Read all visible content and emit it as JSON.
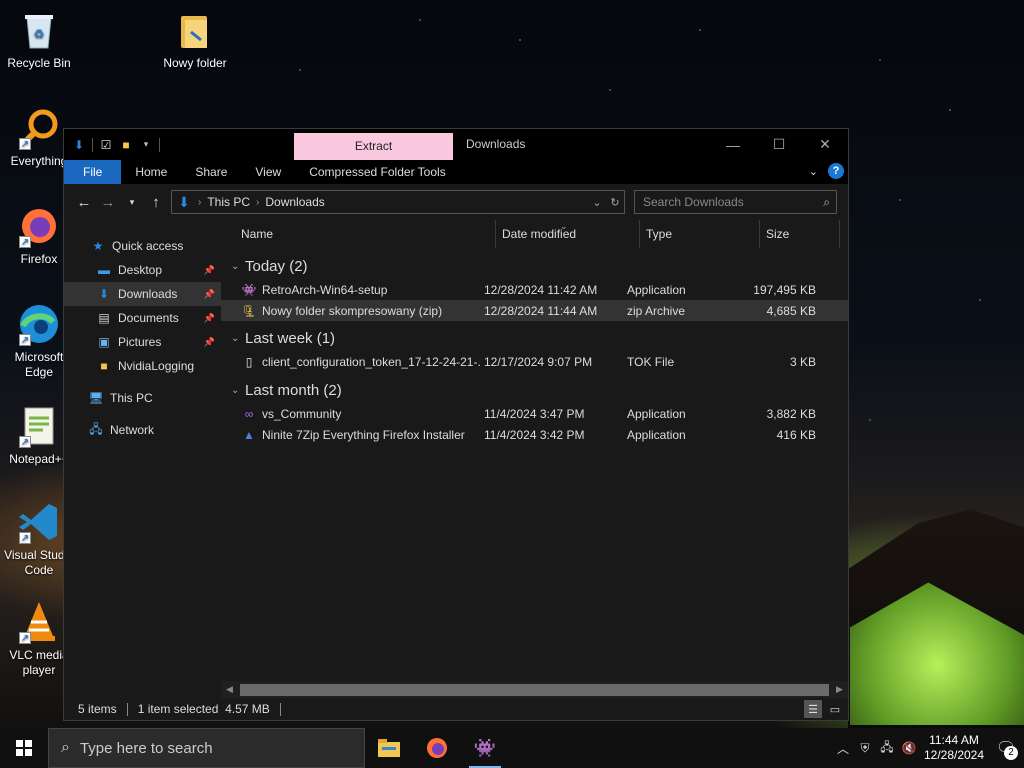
{
  "desktop": {
    "icons": [
      {
        "label": "Recycle Bin",
        "icon": "recycle-bin-icon"
      },
      {
        "label": "Nowy folder",
        "icon": "folder-icon"
      },
      {
        "label": "Everything",
        "icon": "everything-search-icon"
      },
      {
        "label": "Firefox",
        "icon": "firefox-icon"
      },
      {
        "label": "Microsoft Edge",
        "icon": "edge-icon"
      },
      {
        "label": "Notepad++",
        "icon": "notepadpp-icon"
      },
      {
        "label": "Visual Studio Code",
        "icon": "vscode-icon"
      },
      {
        "label": "VLC media player",
        "icon": "vlc-icon"
      }
    ]
  },
  "window": {
    "context_tab": "Extract",
    "title": "Downloads",
    "controls": {
      "minimize": "—",
      "maximize": "☐",
      "close": "✕"
    }
  },
  "ribbon": {
    "tabs": [
      "File",
      "Home",
      "Share",
      "View",
      "Compressed Folder Tools"
    ],
    "help": "?"
  },
  "address": {
    "crumbs": [
      "This PC",
      "Downloads"
    ]
  },
  "search": {
    "placeholder": "Search Downloads"
  },
  "navpane": {
    "quick_access": "Quick access",
    "items": [
      {
        "label": "Desktop",
        "icon": "desktop-icon",
        "pinned": true
      },
      {
        "label": "Downloads",
        "icon": "download-arrow-icon",
        "pinned": true,
        "selected": true
      },
      {
        "label": "Documents",
        "icon": "documents-icon",
        "pinned": true
      },
      {
        "label": "Pictures",
        "icon": "pictures-icon",
        "pinned": true
      },
      {
        "label": "NvidiaLogging",
        "icon": "folder-icon",
        "pinned": false
      }
    ],
    "this_pc": "This PC",
    "network": "Network"
  },
  "columns": [
    "Name",
    "Date modified",
    "Type",
    "Size"
  ],
  "groups": [
    {
      "title": "Today (2)",
      "rows": [
        {
          "name": "RetroArch-Win64-setup",
          "date": "12/28/2024 11:42 AM",
          "type": "Application",
          "size": "197,495 KB",
          "icon": "retroarch-icon",
          "selected": false
        },
        {
          "name": "Nowy folder skompresowany (zip)",
          "date": "12/28/2024 11:44 AM",
          "type": "zip Archive",
          "size": "4,685 KB",
          "icon": "zip-folder-icon",
          "selected": true
        }
      ]
    },
    {
      "title": "Last week (1)",
      "rows": [
        {
          "name": "client_configuration_token_17-12-24-21-...",
          "date": "12/17/2024 9:07 PM",
          "type": "TOK File",
          "size": "3 KB",
          "icon": "file-icon",
          "selected": false
        }
      ]
    },
    {
      "title": "Last month (2)",
      "rows": [
        {
          "name": "vs_Community",
          "date": "11/4/2024 3:47 PM",
          "type": "Application",
          "size": "3,882 KB",
          "icon": "visual-studio-icon",
          "selected": false
        },
        {
          "name": "Ninite 7Zip Everything Firefox Installer",
          "date": "11/4/2024 3:42 PM",
          "type": "Application",
          "size": "416 KB",
          "icon": "ninite-icon",
          "selected": false
        }
      ]
    }
  ],
  "status": {
    "items": "5 items",
    "selection": "1 item selected  4.57 MB"
  },
  "taskbar": {
    "search_placeholder": "Type here to search",
    "apps": [
      {
        "icon": "file-explorer-icon",
        "active": false
      },
      {
        "icon": "firefox-icon",
        "active": false
      },
      {
        "icon": "retroarch-icon",
        "active": true
      }
    ],
    "time": "11:44 AM",
    "date": "12/28/2024",
    "notifications": "2"
  }
}
